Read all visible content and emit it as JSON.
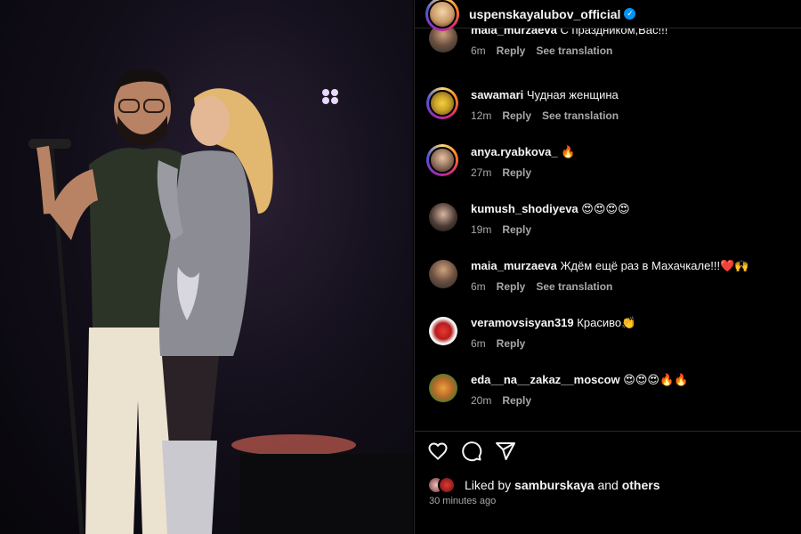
{
  "header": {
    "username": "uspenskayalubov_official",
    "verified_mark": "✓"
  },
  "comments": [
    {
      "user": "maia_murzaeva",
      "text": "С праздником,Вас!!!",
      "time": "6m",
      "reply": "Reply",
      "translate": "See translation",
      "avatar": "man-portrait"
    },
    {
      "user": "sawamari",
      "text": "Чудная женщина",
      "time": "12m",
      "reply": "Reply",
      "translate": "See translation",
      "avatar": "yellow-flower"
    },
    {
      "user": "anya.ryabkova_",
      "text": "🔥",
      "time": "27m",
      "reply": "Reply",
      "avatar": "woman-portrait"
    },
    {
      "user": "kumush_shodiyeva",
      "text": "😍😍😍😍",
      "time": "19m",
      "reply": "Reply",
      "avatar": "woman-dark-hair"
    },
    {
      "user": "maia_murzaeva",
      "text": "Ждём ещё раз в Махачкале!!!❤️🙌",
      "time": "6m",
      "reply": "Reply",
      "translate": "See translation",
      "avatar": "man-portrait"
    },
    {
      "user": "veramovsisyan319",
      "text": "Красиво👏",
      "time": "6m",
      "reply": "Reply",
      "avatar": "red-roses"
    },
    {
      "user": "eda__na__zakaz__moscow",
      "text": "😍😍😍🔥🔥",
      "time": "20m",
      "reply": "Reply",
      "avatar": "food-plate"
    }
  ],
  "likes": {
    "prefix": "Liked by",
    "user": "samburskaya",
    "and": "and",
    "others": "others",
    "time_ago": "30 minutes ago"
  },
  "icons": {
    "like": "heart-icon",
    "comment": "comment-icon",
    "share": "share-icon"
  },
  "colors": {
    "background": "#000000",
    "text": "#f5f5f5",
    "muted": "#a8a8a8",
    "verified": "#0095f6",
    "divider": "#262626"
  }
}
